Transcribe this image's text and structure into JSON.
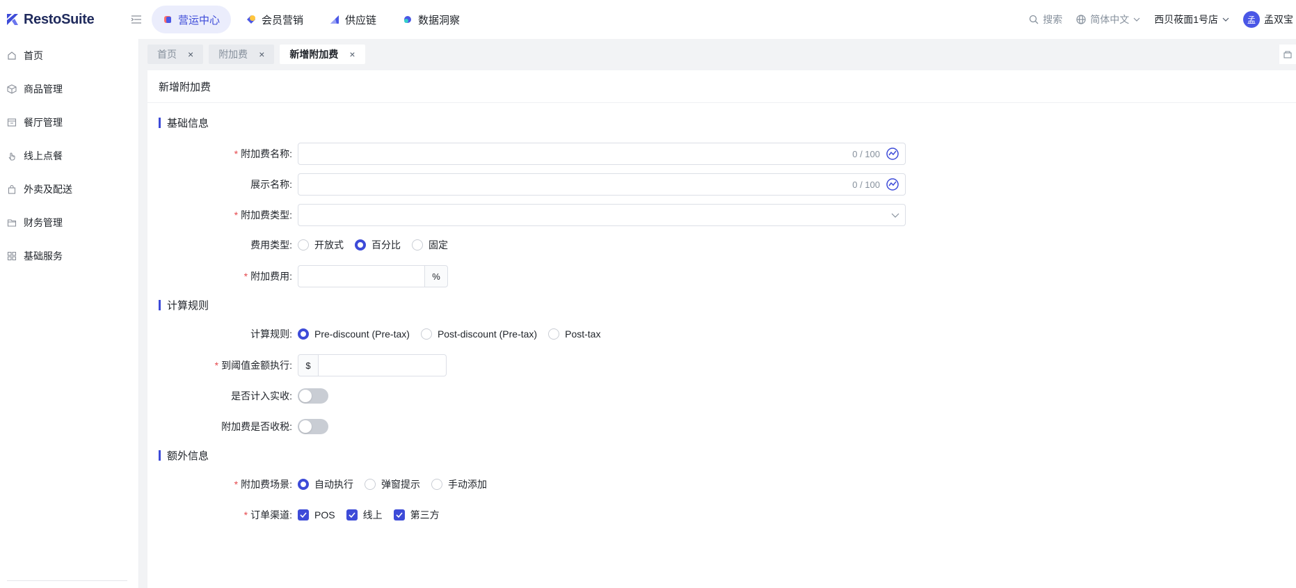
{
  "brand": {
    "name": "RestoSuite",
    "accent": "#3d4bd8"
  },
  "topnav": {
    "items": [
      {
        "label": "营运中心",
        "active": true
      },
      {
        "label": "会员营销",
        "active": false
      },
      {
        "label": "供应链",
        "active": false
      },
      {
        "label": "数据洞察",
        "active": false
      }
    ]
  },
  "topright": {
    "search": "搜索",
    "language": "简体中文",
    "store": "西贝莜面1号店",
    "avatar_char": "孟",
    "user": "孟双宝"
  },
  "sidebar": {
    "items": [
      {
        "label": "首页",
        "icon": "home-icon"
      },
      {
        "label": "商品管理",
        "icon": "box-icon"
      },
      {
        "label": "餐厅管理",
        "icon": "store-icon"
      },
      {
        "label": "线上点餐",
        "icon": "hand-icon"
      },
      {
        "label": "外卖及配送",
        "icon": "bag-icon"
      },
      {
        "label": "财务管理",
        "icon": "folder-icon"
      },
      {
        "label": "基础服务",
        "icon": "grid-icon"
      }
    ]
  },
  "tabs": [
    {
      "label": "首页",
      "active": false
    },
    {
      "label": "附加费",
      "active": false
    },
    {
      "label": "新增附加费",
      "active": true
    }
  ],
  "page": {
    "title": "新增附加费",
    "sections": {
      "basic": "基础信息",
      "calc": "计算规则",
      "extra": "额外信息"
    },
    "fields": {
      "name_label": "附加费名称:",
      "name_count": "0 / 100",
      "display_label": "展示名称:",
      "display_count": "0 / 100",
      "type_label": "附加费类型:",
      "fee_type_label": "费用类型:",
      "fee_type_options": [
        "开放式",
        "百分比",
        "固定"
      ],
      "fee_type_selected": "百分比",
      "fee_label": "附加费用:",
      "fee_suffix": "%",
      "calc_label": "计算规则:",
      "calc_options": [
        "Pre-discount (Pre-tax)",
        "Post-discount (Pre-tax)",
        "Post-tax"
      ],
      "calc_selected": "Pre-discount (Pre-tax)",
      "threshold_label": "到阈值金额执行:",
      "threshold_prefix": "$",
      "revenue_label": "是否计入实收:",
      "tax_label": "附加费是否收税:",
      "scene_label": "附加费场景:",
      "scene_options": [
        "自动执行",
        "弹窗提示",
        "手动添加"
      ],
      "scene_selected": "自动执行",
      "channel_label": "订单渠道:",
      "channel_options": [
        "POS",
        "线上",
        "第三方"
      ]
    }
  }
}
